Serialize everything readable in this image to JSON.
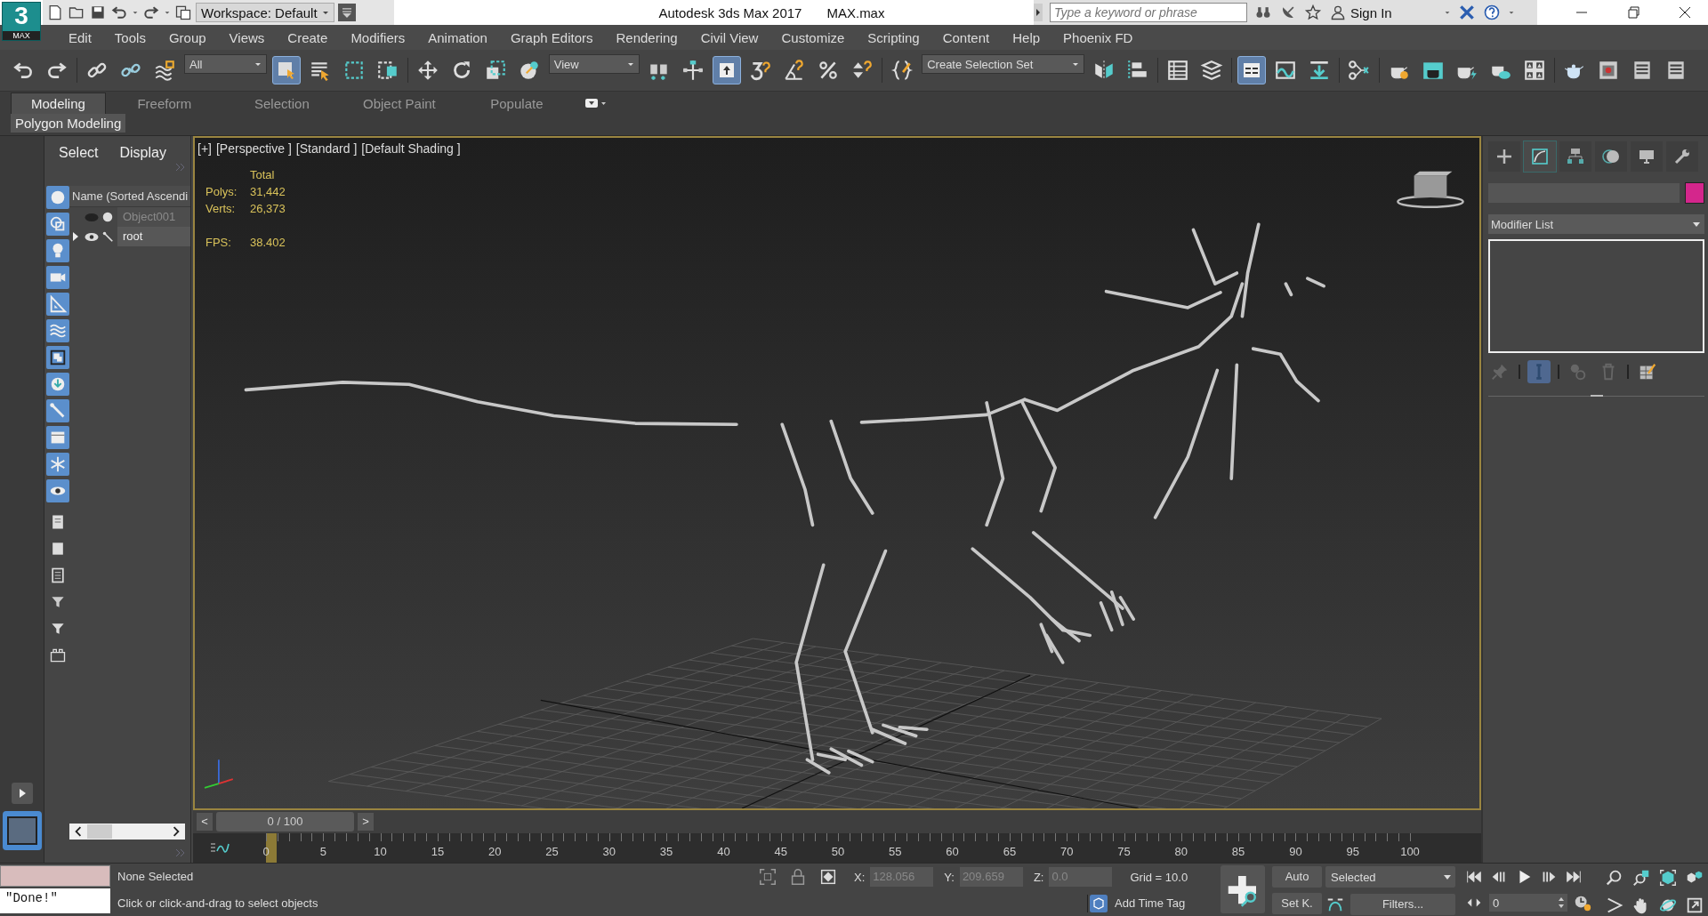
{
  "title_bar": {
    "logo": {
      "digit": "3",
      "label": "MAX"
    },
    "workspace": "Workspace: Default",
    "app_title": "Autodesk 3ds Max 2017",
    "file_name": "MAX.max",
    "search": {
      "placeholder": "Type a keyword or phrase"
    },
    "sign_in": "Sign In"
  },
  "menu": [
    "Edit",
    "Tools",
    "Group",
    "Views",
    "Create",
    "Modifiers",
    "Animation",
    "Graph Editors",
    "Rendering",
    "Civil View",
    "Customize",
    "Scripting",
    "Content",
    "Help",
    "Phoenix FD"
  ],
  "toolbar": {
    "selection_filter": "All",
    "reference_coord": "View",
    "selection_set": "Create Selection Set"
  },
  "ribbon": {
    "tabs": [
      {
        "label": "Modeling",
        "selected": true
      },
      {
        "label": "Freeform",
        "selected": false
      },
      {
        "label": "Selection",
        "selected": false
      },
      {
        "label": "Object Paint",
        "selected": false
      },
      {
        "label": "Populate",
        "selected": false
      }
    ],
    "panel": "Polygon Modeling"
  },
  "scene_explorer": {
    "tabs": [
      "Select",
      "Display"
    ],
    "column": "Name (Sorted Ascendi",
    "items": [
      {
        "name": "Object001",
        "kind": "geometry",
        "hidden": true,
        "expandable": false
      },
      {
        "name": "root",
        "kind": "bone",
        "hidden": false,
        "expandable": true
      }
    ]
  },
  "viewport": {
    "labels": [
      "[+]",
      "[Perspective ]",
      "[Standard ]",
      "[Default Shading ]"
    ],
    "stats_header": "Total",
    "stats": [
      {
        "label": "Polys:",
        "value": "31,442"
      },
      {
        "label": "Verts:",
        "value": "26,373"
      }
    ],
    "fps": {
      "label": "FPS:",
      "value": "38.402"
    }
  },
  "command_panel": {
    "tabs": [
      {
        "kind": "create",
        "selected": false
      },
      {
        "kind": "modify",
        "selected": true
      },
      {
        "kind": "hierarchy",
        "selected": false
      },
      {
        "kind": "motion",
        "selected": false
      },
      {
        "kind": "display",
        "selected": false
      },
      {
        "kind": "utilities",
        "selected": false
      }
    ],
    "modifier_list": "Modifier List"
  },
  "time_slider": {
    "label": "0 / 100",
    "level": 0,
    "prev": "<",
    "next": ">"
  },
  "frame_labels": [
    "0",
    "5",
    "10",
    "15",
    "20",
    "25",
    "30",
    "35",
    "40",
    "45",
    "50",
    "55",
    "60",
    "65",
    "70",
    "75",
    "80",
    "85",
    "90",
    "95",
    "100"
  ],
  "status": {
    "script_output": "\"Done!\"",
    "selection": "None Selected",
    "prompt": "Click or click-and-drag to select objects",
    "coords": [
      {
        "label": "X:",
        "value": "128.056",
        "disabled": true
      },
      {
        "label": "Y:",
        "value": "209.659",
        "disabled": true
      },
      {
        "label": "Z:",
        "value": "0.0",
        "disabled": true
      }
    ],
    "grid": "Grid = 10.0",
    "add_time_tag": "Add Time Tag"
  },
  "animation": {
    "auto": "Auto",
    "set_key": "Set K.",
    "key_filter": "Selected",
    "filters": "Filters...",
    "frame": "0"
  }
}
